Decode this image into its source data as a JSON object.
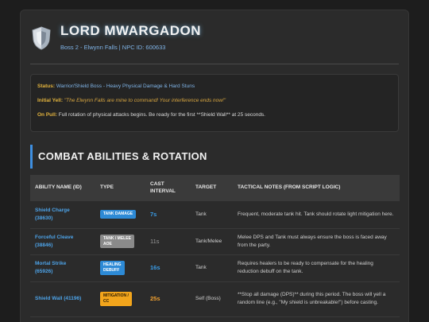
{
  "header": {
    "title": "LORD MWARGADON",
    "subtitle": "Boss 2 - Elwynn Falls | NPC ID: 600633"
  },
  "info": {
    "status_label": "Status:",
    "status_value": "Warrior/Shield Boss - Heavy Physical Damage & Hard Stuns",
    "yell_label": "Initial Yell:",
    "yell_value": "\"The Elwynn Falls are mine to command! Your interference ends now!\"",
    "pull_label": "On Pull:",
    "pull_value": "Full rotation of physical attacks begins. Be ready for the first **Shield Wall** at 25 seconds."
  },
  "section": {
    "title": "COMBAT ABILITIES & ROTATION"
  },
  "table": {
    "headers": {
      "name": "ABILITY NAME (ID)",
      "type": "TYPE",
      "cast_1": "CAST",
      "cast_2": "INTERVAL",
      "target": "TARGET",
      "notes": "TACTICAL NOTES (FROM SCRIPT LOGIC)"
    },
    "rows": [
      {
        "name_1": "Shield Charge",
        "name_2": "(38630)",
        "type_1": "TANK DAMAGE",
        "type_2": "",
        "badge_bg": "#2d8ad6",
        "badge_fg": "#ffffff",
        "interval": "7s",
        "interval_style": "blue",
        "target": "Tank",
        "notes": "Frequent, moderate tank hit. Tank should rotate light mitigation here."
      },
      {
        "name_1": "Forceful Cleave",
        "name_2": "(38846)",
        "type_1": "TANK / MELEE",
        "type_2": "AOE",
        "badge_bg": "#8a8a8a",
        "badge_fg": "#ffffff",
        "interval": "11s",
        "interval_style": "gray",
        "target": "Tank/Melee",
        "notes": "Melee DPS and Tank must always ensure the boss is faced away from the party."
      },
      {
        "name_1": "Mortal Strike",
        "name_2": "(65926)",
        "type_1": "HEALING",
        "type_2": "DEBUFF",
        "badge_bg": "#2d8ad6",
        "badge_fg": "#ffffff",
        "interval": "16s",
        "interval_style": "blue",
        "target": "Tank",
        "notes": "Requires healers to be ready to compensate for the healing reduction debuff on the tank."
      },
      {
        "name_1": "Shield Wall (41196)",
        "name_2": "",
        "type_1": "MITIGATION /",
        "type_2": "CC",
        "badge_bg": "#f2a51c",
        "badge_fg": "#2a1a00",
        "interval": "25s",
        "interval_style": "orange",
        "target": "Self (Boss)",
        "notes": "**Stop all damage (DPS)** during this period. The boss will yell a random line (e.g., \"My shield is unbreakable!\") before casting."
      }
    ]
  },
  "colors": {
    "accent": "#3e8fe0",
    "label_gold": "#e2b33d",
    "link_blue": "#4da3e8"
  },
  "icons": {
    "boss": "shield-icon"
  }
}
